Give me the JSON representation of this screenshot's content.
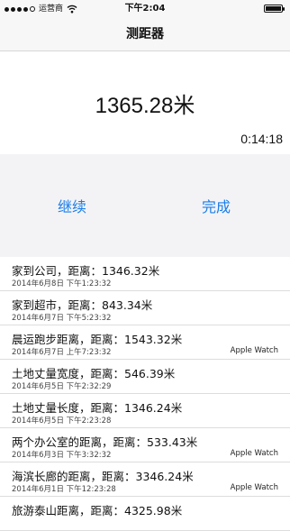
{
  "status_bar": {
    "carrier": "运营商",
    "time": "下午2:04",
    "battery_level": 1.0
  },
  "nav": {
    "title": "测距器"
  },
  "readout": {
    "distance": "1365.28米",
    "elapsed": "0:14:18"
  },
  "actions": {
    "continue_label": "继续",
    "done_label": "完成"
  },
  "history": [
    {
      "title": "家到公司，距离：1346.32米",
      "date": "2014年6月8日 下午1:23:32",
      "source": ""
    },
    {
      "title": "家到超市，距离：843.34米",
      "date": "2014年6月7日 下午5:23:32",
      "source": ""
    },
    {
      "title": "晨运跑步距离，距离：1543.32米",
      "date": "2014年6月7日 上午7:23:32",
      "source": "Apple Watch"
    },
    {
      "title": "土地丈量宽度，距离：546.39米",
      "date": "2014年6月5日 下午2:32:29",
      "source": ""
    },
    {
      "title": "土地丈量长度，距离：1346.24米",
      "date": "2014年6月5日 下午2:23:28",
      "source": ""
    },
    {
      "title": "两个办公室的距离，距离：533.43米",
      "date": "2014年6月3日 下午3:32:32",
      "source": "Apple Watch"
    },
    {
      "title": "海滨长廊的距离，距离：3346.24米",
      "date": "2014年6月1日 下午12:23:28",
      "source": "Apple Watch"
    },
    {
      "title": "旅游泰山距离，距离：4325.98米",
      "date": "",
      "source": ""
    }
  ]
}
